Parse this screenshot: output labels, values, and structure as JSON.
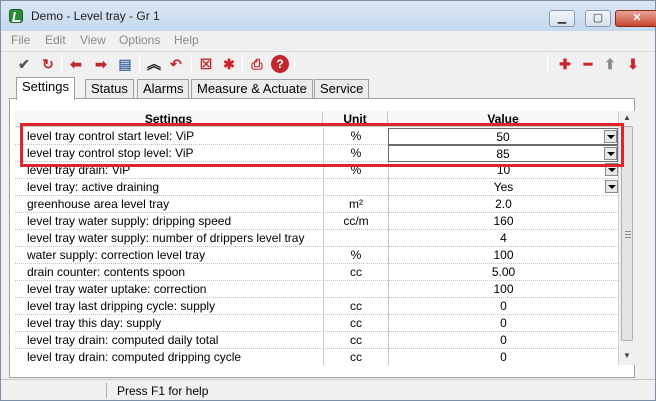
{
  "window": {
    "title": "Demo - Level tray - Gr 1"
  },
  "menu": [
    "File",
    "Edit",
    "View",
    "Options",
    "Help"
  ],
  "toolbar": [
    {
      "icon": "check-icon",
      "glyph": "✔",
      "color": "#555555"
    },
    {
      "icon": "refresh-icon",
      "glyph": "↻",
      "color": "#c0282d"
    },
    {
      "icon": "arrow-left-icon",
      "glyph": "⬅",
      "color": "#c0282d"
    },
    {
      "icon": "arrow-right-icon",
      "glyph": "➡",
      "color": "#c0282d"
    },
    {
      "icon": "table-icon",
      "glyph": "▤",
      "color": "#4a6fa5"
    },
    {
      "icon": "collapse-up-icon",
      "glyph": "︽",
      "color": "#222222"
    },
    {
      "icon": "undo-icon",
      "glyph": "↶",
      "color": "#c0282d"
    },
    {
      "icon": "delete-box-icon",
      "glyph": "☒",
      "color": "#c0282d"
    },
    {
      "icon": "asterisk-icon",
      "glyph": "✱",
      "color": "#d0202a"
    },
    {
      "icon": "printer-icon",
      "glyph": "⎙",
      "color": "#c0282d"
    },
    {
      "icon": "help-icon",
      "glyph": "?",
      "color": "#ffffff"
    },
    {
      "icon": "plus-icon",
      "glyph": "✚",
      "color": "#d0202a"
    },
    {
      "icon": "minus-icon",
      "glyph": "━",
      "color": "#d0202a"
    },
    {
      "icon": "arrow-up-icon",
      "glyph": "⬆",
      "color": "#8a8a8a"
    },
    {
      "icon": "arrow-down-icon",
      "glyph": "⬇",
      "color": "#d0202a"
    }
  ],
  "tabs": [
    "Settings",
    "Status",
    "Alarms",
    "Measure & Actuate",
    "Service"
  ],
  "grid": {
    "headers": {
      "settings": "Settings",
      "unit": "Unit",
      "value": "Value"
    },
    "rows": [
      {
        "name": "level tray control start level: ViP",
        "unit": "%",
        "value": "50"
      },
      {
        "name": "level tray control stop level: ViP",
        "unit": "%",
        "value": "85"
      },
      {
        "name": "level tray drain: ViP",
        "unit": "%",
        "value": "10"
      },
      {
        "name": "level tray: active draining",
        "unit": "",
        "value": "Yes"
      },
      {
        "name": "greenhouse area level tray",
        "unit": "m²",
        "value": "2.0"
      },
      {
        "name": "level tray water supply: dripping speed",
        "unit": "cc/m",
        "value": "160"
      },
      {
        "name": "level tray water supply: number of drippers level tray",
        "unit": "",
        "value": "4"
      },
      {
        "name": "water supply: correction level tray",
        "unit": "%",
        "value": "100"
      },
      {
        "name": "drain counter: contents spoon",
        "unit": "cc",
        "value": "5.00"
      },
      {
        "name": "level tray water uptake: correction",
        "unit": "",
        "value": "100"
      },
      {
        "name": "level tray last dripping cycle: supply",
        "unit": "cc",
        "value": "0"
      },
      {
        "name": "level tray this day: supply",
        "unit": "cc",
        "value": "0"
      },
      {
        "name": "level tray drain: computed daily total",
        "unit": "cc",
        "value": "0"
      },
      {
        "name": "level tray drain: computed dripping cycle",
        "unit": "cc",
        "value": "0"
      }
    ]
  },
  "status": {
    "help_text": "Press F1 for help"
  },
  "colors": {
    "highlight": "#e0242c",
    "titlebar": "#c5d8ee"
  }
}
